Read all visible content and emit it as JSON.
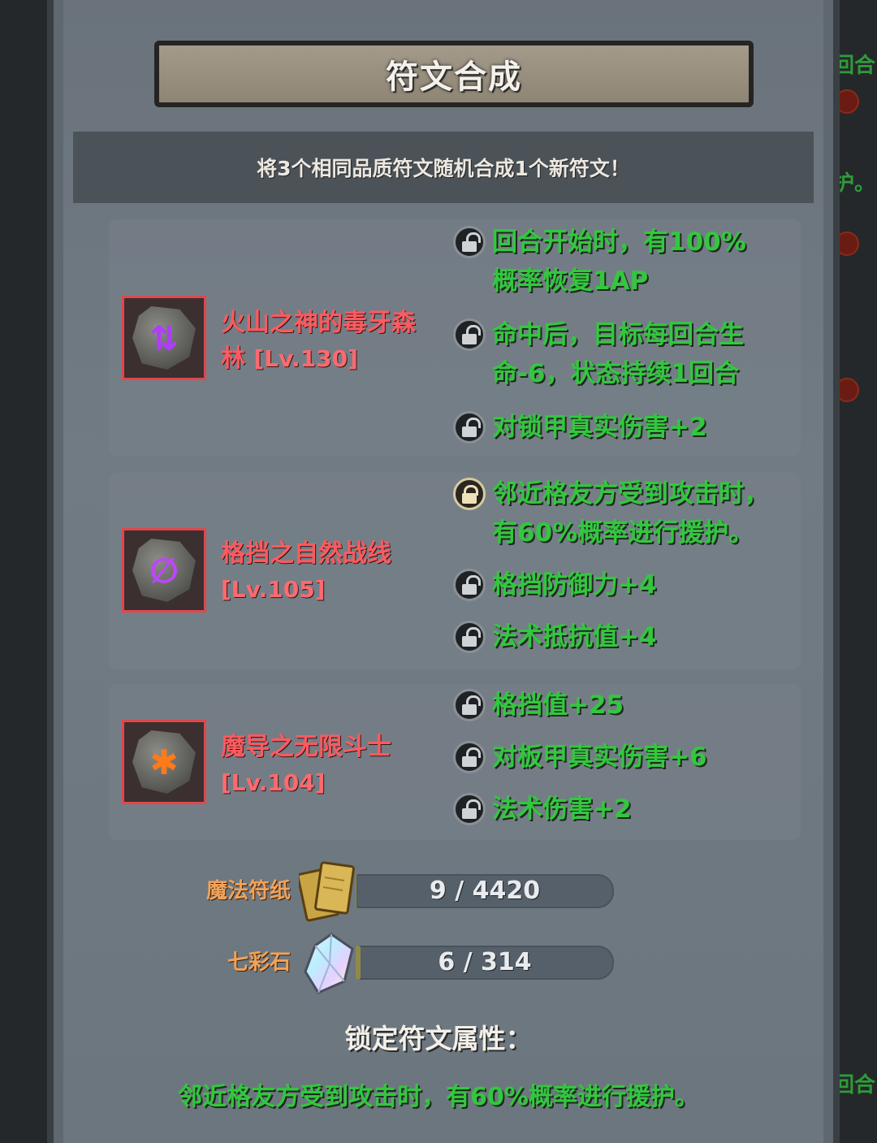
{
  "title": "符文合成",
  "subtitle": "将3个相同品质符文随机合成1个新符文！",
  "runes": [
    {
      "name": "火山之神的毒牙森林",
      "level": "[Lv.130]",
      "glyph": "⇅",
      "glyph_color": "#b03cff",
      "attributes": [
        {
          "lines": [
            "回合开始时，有100%",
            "概率恢复1AP"
          ],
          "locked": false
        },
        {
          "lines": [
            "命中后，目标每回合生",
            "命-6，状态持续1回合"
          ],
          "locked": false
        },
        {
          "lines": [
            "对锁甲真实伤害+2"
          ],
          "locked": false
        }
      ]
    },
    {
      "name": "格挡之自然战线",
      "level": "[Lv.105]",
      "glyph": "∅",
      "glyph_color": "#c044ff",
      "attributes": [
        {
          "lines": [
            "邻近格友方受到攻击时，",
            "有60%概率进行援护。"
          ],
          "locked": true
        },
        {
          "lines": [
            "格挡防御力+4"
          ],
          "locked": false
        },
        {
          "lines": [
            "法术抵抗值+4"
          ],
          "locked": false
        }
      ]
    },
    {
      "name": "魔导之无限斗士",
      "level": "[Lv.104]",
      "glyph": "✱",
      "glyph_color": "#ff7a1a",
      "attributes": [
        {
          "lines": [
            "格挡值+25"
          ],
          "locked": false
        },
        {
          "lines": [
            "对板甲真实伤害+6"
          ],
          "locked": false
        },
        {
          "lines": [
            "法术伤害+2"
          ],
          "locked": false
        }
      ]
    }
  ],
  "resources": [
    {
      "label": "魔法符纸",
      "value": "9 / 4420",
      "current": 9,
      "max": 4420,
      "icon": "paper-cards-icon"
    },
    {
      "label": "七彩石",
      "value": "6 / 314",
      "current": 6,
      "max": 314,
      "icon": "rainbow-crystal-icon"
    }
  ],
  "locked_attribute_title": "锁定符文属性：",
  "locked_attribute_text": "邻近格友方受到攻击时，有60%概率进行援护。",
  "background_peek": {
    "right_text_1": "回合",
    "right_text_2": "护。",
    "right_text_3": "回合"
  }
}
